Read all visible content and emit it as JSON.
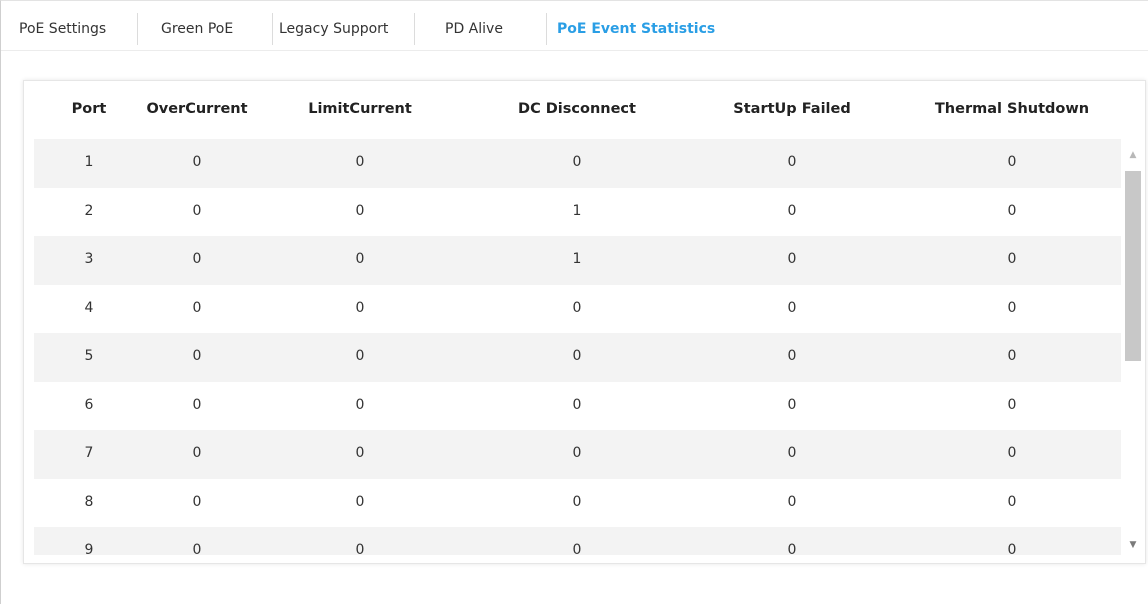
{
  "tabs": [
    {
      "label": "PoE Settings",
      "active": false
    },
    {
      "label": "Green PoE",
      "active": false
    },
    {
      "label": "Legacy Support",
      "active": false
    },
    {
      "label": "PD Alive",
      "active": false
    },
    {
      "label": "PoE Event Statistics",
      "active": true
    }
  ],
  "table": {
    "headers": [
      "Port",
      "OverCurrent",
      "LimitCurrent",
      "DC Disconnect",
      "StartUp Failed",
      "Thermal Shutdown"
    ],
    "rows": [
      [
        "1",
        "0",
        "0",
        "0",
        "0",
        "0"
      ],
      [
        "2",
        "0",
        "0",
        "1",
        "0",
        "0"
      ],
      [
        "3",
        "0",
        "0",
        "1",
        "0",
        "0"
      ],
      [
        "4",
        "0",
        "0",
        "0",
        "0",
        "0"
      ],
      [
        "5",
        "0",
        "0",
        "0",
        "0",
        "0"
      ],
      [
        "6",
        "0",
        "0",
        "0",
        "0",
        "0"
      ],
      [
        "7",
        "0",
        "0",
        "0",
        "0",
        "0"
      ],
      [
        "8",
        "0",
        "0",
        "0",
        "0",
        "0"
      ],
      [
        "9",
        "0",
        "0",
        "0",
        "0",
        "0"
      ]
    ]
  },
  "scrollbar": {
    "up_icon": "triangle-up-icon",
    "down_icon": "triangle-down-icon"
  },
  "colors": {
    "active_tab": "#2a9ee5",
    "row_stripe": "#f3f3f3"
  }
}
